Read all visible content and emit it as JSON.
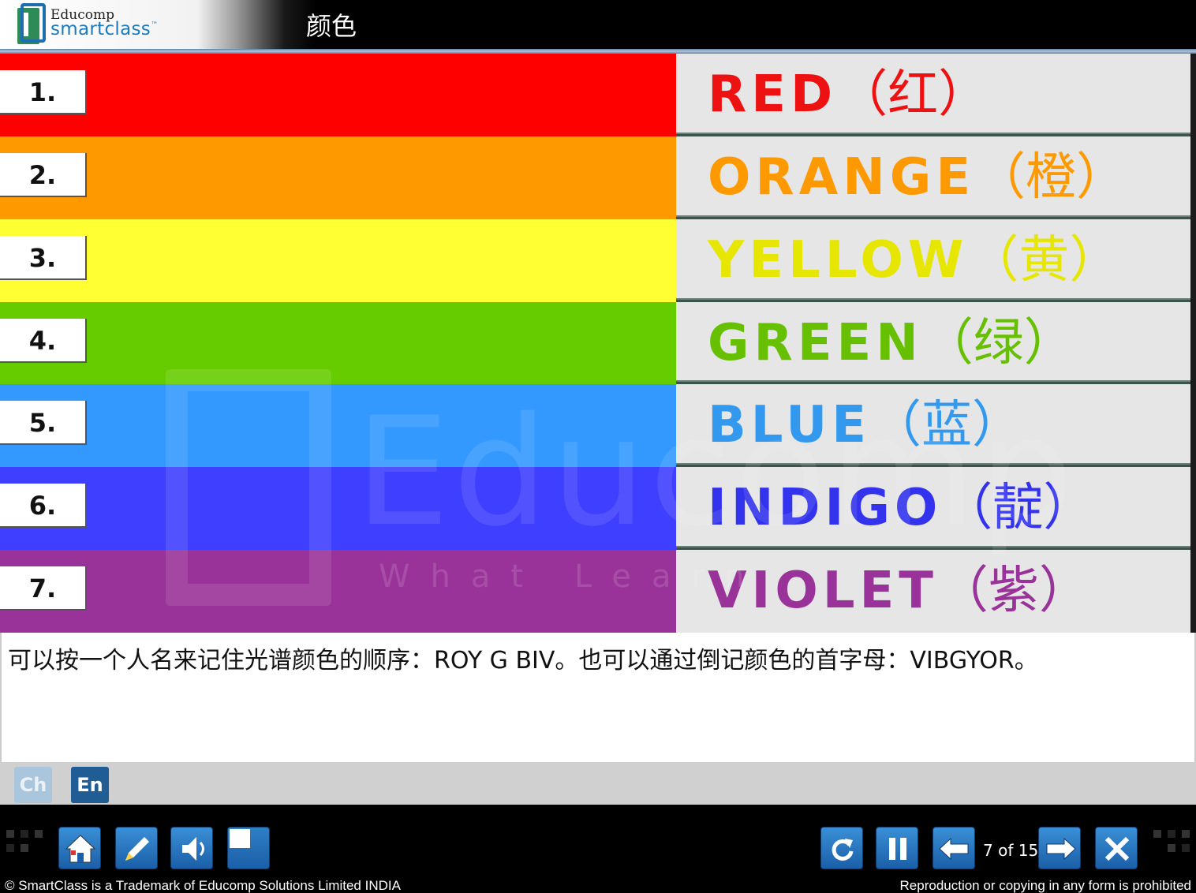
{
  "header": {
    "logo_top": "Educomp",
    "logo_bottom": "smartclass",
    "logo_tm": "™",
    "title": "颜色"
  },
  "colors": [
    {
      "number": "1.",
      "name": "RED",
      "cn": "（红）",
      "band": "#ff0000",
      "text": "#ee1111"
    },
    {
      "number": "2.",
      "name": "ORANGE",
      "cn": "（橙）",
      "band": "#ff9900",
      "text": "#ff9900"
    },
    {
      "number": "3.",
      "name": "YELLOW",
      "cn": "（黄）",
      "band": "#ffff33",
      "text": "#e6e600"
    },
    {
      "number": "4.",
      "name": "GREEN",
      "cn": "（绿）",
      "band": "#66cc00",
      "text": "#66c000"
    },
    {
      "number": "5.",
      "name": "BLUE",
      "cn": "（蓝）",
      "band": "#3399ff",
      "text": "#3399ee"
    },
    {
      "number": "6.",
      "name": "INDIGO",
      "cn": "（靛）",
      "band": "#3f3fff",
      "text": "#3333ee"
    },
    {
      "number": "7.",
      "name": "VIOLET",
      "cn": "（紫）",
      "band": "#993399",
      "text": "#993399"
    }
  ],
  "watermark": {
    "brand": "Educomp",
    "tagline": "What Learn"
  },
  "caption": {
    "text": "可以按一个人名来记住光谱颜色的顺序：ROY G BIV。也可以通过倒记颜色的首字母：VIBGYOR。"
  },
  "language": {
    "ch_label": "Ch",
    "en_label": "En"
  },
  "controls": {
    "page_counter": "7 of 15",
    "icons": [
      "home-icon",
      "pencil-icon",
      "speaker-icon",
      "whiteboard-icon",
      "replay-icon",
      "pause-icon",
      "back-arrow-icon",
      "next-arrow-icon",
      "close-icon"
    ]
  },
  "footer": {
    "left": "© SmartClass is a Trademark of Educomp Solutions Limited INDIA",
    "right": "Reproduction or copying in any form is prohibited"
  }
}
